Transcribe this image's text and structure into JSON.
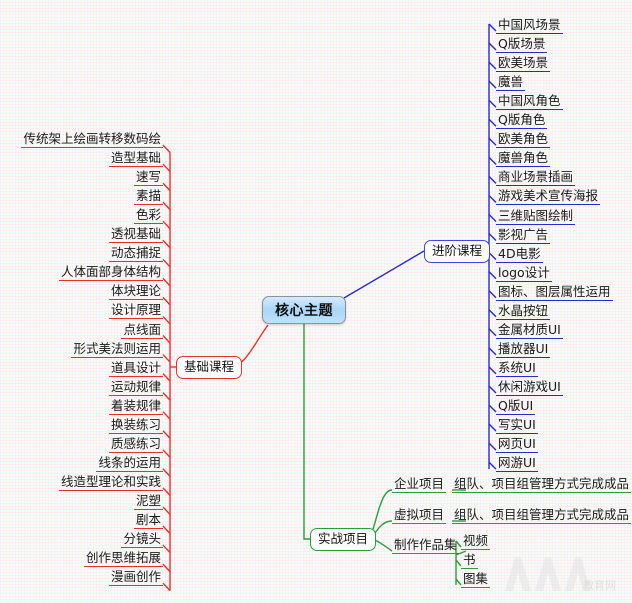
{
  "diagram": {
    "type": "mind-map",
    "title": "核心主题",
    "colors": {
      "core_border": "#8e9199",
      "core_fill": "#a9d6f7",
      "branch_basic": "#e8302c",
      "branch_advanced": "#2b2bc8",
      "branch_practice": "#2e9b3c",
      "background": "#fbfafa"
    },
    "core": {
      "label": "核心主题"
    },
    "branches": [
      {
        "id": "basic",
        "label": "基础课程",
        "color": "#e8302c",
        "side": "left",
        "children": [
          {
            "label": "传统架上绘画转移数码绘"
          },
          {
            "label": "造型基础"
          },
          {
            "label": "速写"
          },
          {
            "label": "素描"
          },
          {
            "label": "色彩"
          },
          {
            "label": "透视基础"
          },
          {
            "label": "动态捕捉"
          },
          {
            "label": "人体面部身体结构"
          },
          {
            "label": "体块理论"
          },
          {
            "label": "设计原理"
          },
          {
            "label": "点线面"
          },
          {
            "label": "形式美法则运用"
          },
          {
            "label": "道具设计"
          },
          {
            "label": "运动规律"
          },
          {
            "label": "着装规律"
          },
          {
            "label": "换装练习"
          },
          {
            "label": "质感练习"
          },
          {
            "label": "线条的运用"
          },
          {
            "label": "线造型理论和实践"
          },
          {
            "label": "泥塑"
          },
          {
            "label": "剧本"
          },
          {
            "label": "分镜头"
          },
          {
            "label": "创作思维拓展"
          },
          {
            "label": "漫画创作"
          }
        ]
      },
      {
        "id": "advanced",
        "label": "进阶课程",
        "color": "#2b2bc8",
        "side": "right",
        "children": [
          {
            "label": "中国风场景"
          },
          {
            "label": "Q版场景"
          },
          {
            "label": "欧美场景"
          },
          {
            "label": "魔兽"
          },
          {
            "label": "中国风角色"
          },
          {
            "label": "Q版角色"
          },
          {
            "label": "欧美角色"
          },
          {
            "label": "魔兽角色"
          },
          {
            "label": "商业场景插画"
          },
          {
            "label": "游戏美术宣传海报"
          },
          {
            "label": "三维贴图绘制"
          },
          {
            "label": "影视广告"
          },
          {
            "label": "4D电影"
          },
          {
            "label": "logo设计"
          },
          {
            "label": "图标、图层属性运用"
          },
          {
            "label": "水晶按钮"
          },
          {
            "label": "金属材质UI"
          },
          {
            "label": "播放器UI"
          },
          {
            "label": "系统UI"
          },
          {
            "label": "休闲游戏UI"
          },
          {
            "label": "Q版UI"
          },
          {
            "label": "写实UI"
          },
          {
            "label": "网页UI"
          },
          {
            "label": "网游UI"
          }
        ]
      },
      {
        "id": "practice",
        "label": "实战项目",
        "color": "#2e9b3c",
        "side": "bottom-right",
        "children": [
          {
            "label": "企业项目",
            "children": [
              {
                "label": "组队、项目组管理方式完成成品"
              }
            ]
          },
          {
            "label": "虚拟项目",
            "children": [
              {
                "label": "组队、项目组管理方式完成成品"
              }
            ]
          },
          {
            "label": "制作作品集",
            "children": [
              {
                "label": "视频"
              },
              {
                "label": "书"
              },
              {
                "label": "图集"
              }
            ]
          }
        ]
      }
    ]
  },
  "watermark": {
    "logo": "AAA",
    "text": "教育网"
  }
}
